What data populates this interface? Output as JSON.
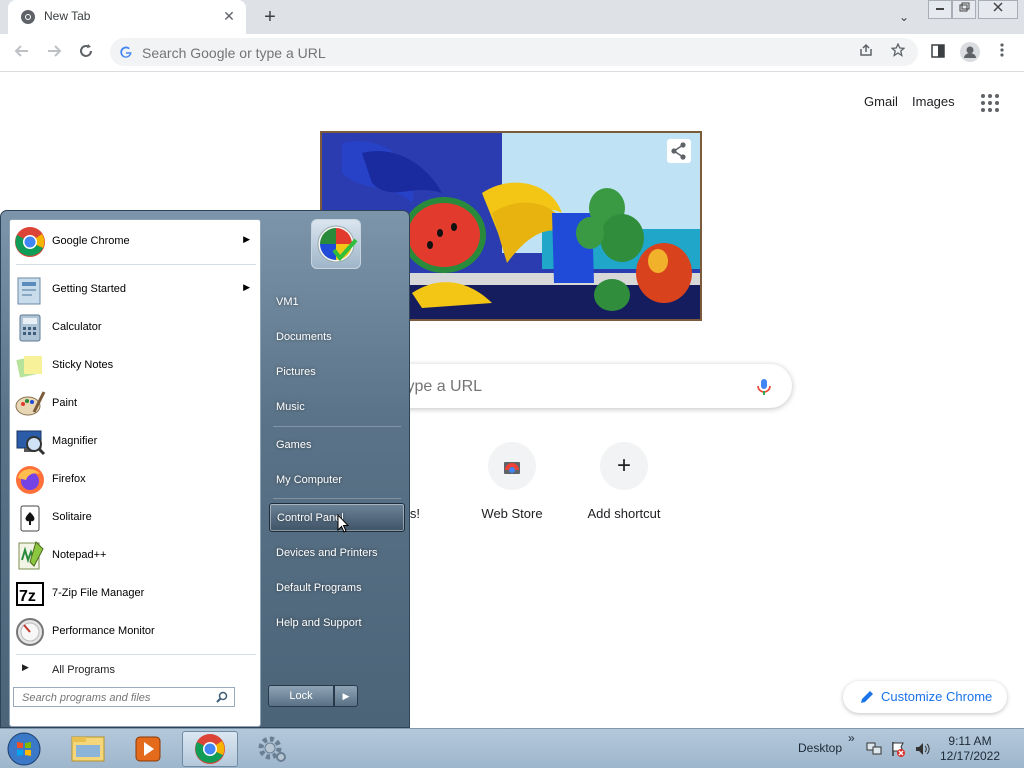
{
  "browser": {
    "tab_title": "New Tab",
    "tab_close": "✕",
    "new_tab": "+",
    "tab_search": "⌄",
    "omnibox_placeholder": "Search Google or type a URL"
  },
  "ntp": {
    "gmail": "Gmail",
    "images": "Images",
    "search_placeholder": "type a URL",
    "shortcuts": [
      {
        "label": "s!"
      },
      {
        "label": "Web Store"
      },
      {
        "label": "Add shortcut",
        "icon": "+"
      }
    ],
    "customize": "Customize Chrome"
  },
  "start_menu": {
    "programs": [
      {
        "label": "Google Chrome",
        "icon": "chrome-icon",
        "submenu": true
      },
      {
        "label": "Getting Started",
        "icon": "getting-started-icon",
        "submenu": true
      },
      {
        "label": "Calculator",
        "icon": "calculator-icon"
      },
      {
        "label": "Sticky Notes",
        "icon": "sticky-notes-icon"
      },
      {
        "label": "Paint",
        "icon": "paint-icon"
      },
      {
        "label": "Magnifier",
        "icon": "magnifier-icon"
      },
      {
        "label": "Firefox",
        "icon": "firefox-icon"
      },
      {
        "label": "Solitaire",
        "icon": "solitaire-icon"
      },
      {
        "label": "Notepad++",
        "icon": "notepadpp-icon"
      },
      {
        "label": "7-Zip File Manager",
        "icon": "7zip-icon"
      },
      {
        "label": "Performance Monitor",
        "icon": "performance-monitor-icon"
      }
    ],
    "all_programs": "All Programs",
    "search_placeholder": "Search programs and files",
    "right_links": [
      {
        "label": "VM1"
      },
      {
        "label": "Documents"
      },
      {
        "label": "Pictures"
      },
      {
        "label": "Music"
      },
      {
        "label": "Games"
      },
      {
        "label": "My Computer"
      },
      {
        "label": "Control Panel"
      },
      {
        "label": "Devices and Printers"
      },
      {
        "label": "Default Programs"
      },
      {
        "label": "Help and Support"
      }
    ],
    "lock": "Lock",
    "lock_arrow": "▶"
  },
  "taskbar": {
    "desktop": "Desktop",
    "chevron": "»",
    "time": "9:11 AM",
    "date": "12/17/2022"
  }
}
